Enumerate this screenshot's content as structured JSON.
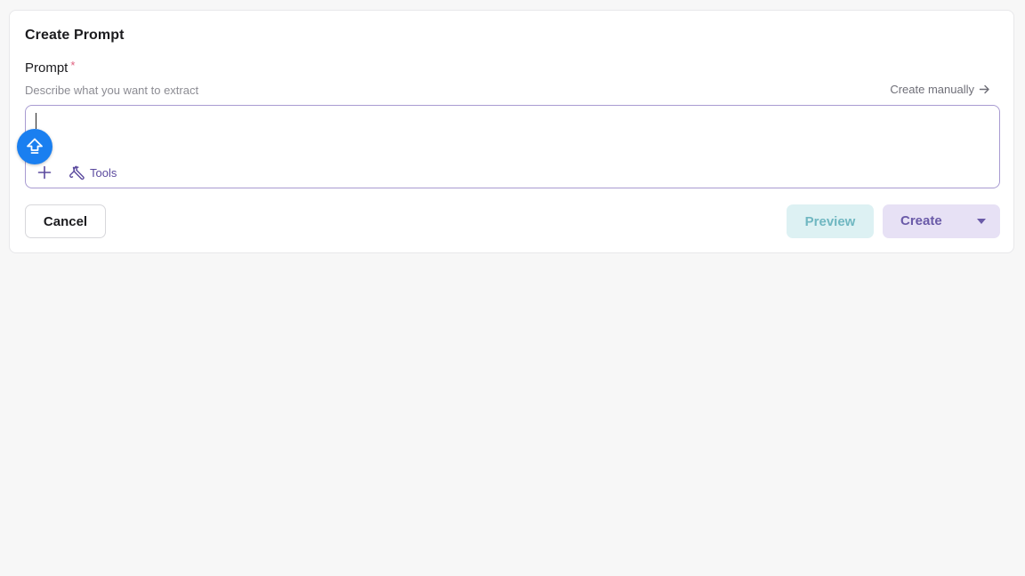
{
  "dialog": {
    "title": "Create Prompt"
  },
  "prompt_field": {
    "label": "Prompt",
    "required_mark": "*",
    "helper_text": "Describe what you want to extract",
    "value": "",
    "placeholder": ""
  },
  "manual_link": {
    "label": "Create manually",
    "icon": "arrow-right-icon"
  },
  "toolbar": {
    "add_icon": "plus-icon",
    "tools_icon": "wrench-icon",
    "tools_label": "Tools"
  },
  "upload_badge": {
    "icon": "upload-arrow-icon",
    "color": "#1a7ff0"
  },
  "actions": {
    "cancel_label": "Cancel",
    "preview_label": "Preview",
    "create_label": "Create",
    "create_dropdown_icon": "caret-down-icon"
  },
  "colors": {
    "accent": "#5b4a9e",
    "input_border": "#a89bd1",
    "preview_bg": "#ddf1f3",
    "create_bg": "#e7e1f5",
    "required": "#e0607e"
  }
}
